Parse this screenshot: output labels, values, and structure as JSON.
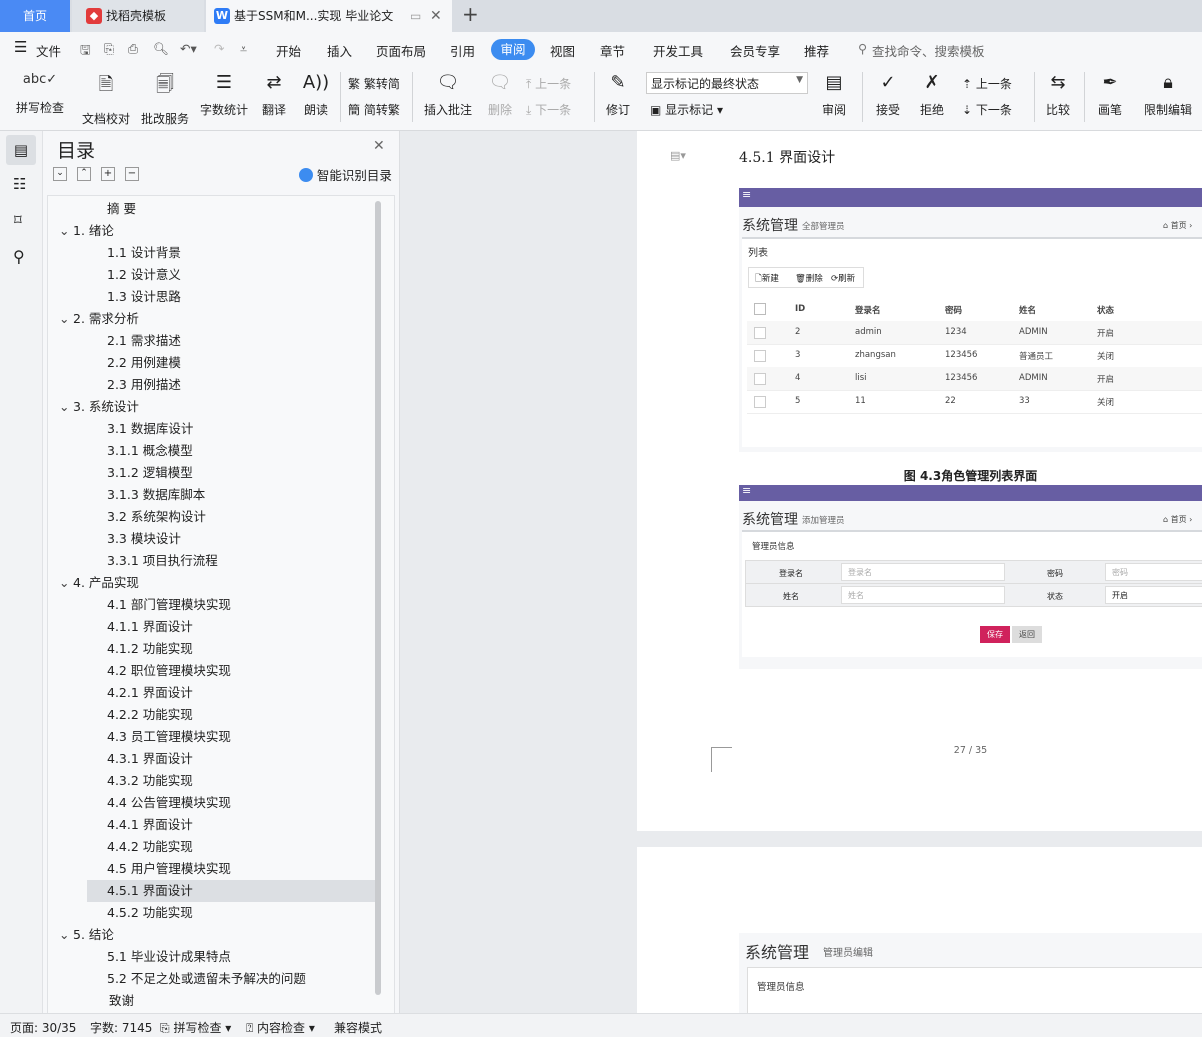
{
  "tabs": {
    "home": "首页",
    "template": "找稻壳模板",
    "document": "基于SSM和M...实现 毕业论文"
  },
  "menu": {
    "file": "文件",
    "items": [
      "开始",
      "插入",
      "页面布局",
      "引用",
      "审阅",
      "视图",
      "章节",
      "开发工具",
      "会员专享",
      "推荐"
    ],
    "search_placeholder": "查找命令、搜索模板"
  },
  "ribbon": {
    "spellcheck": "拼写检查",
    "doc_proof": "文档校对",
    "batch_service": "批改服务",
    "word_count": "字数统计",
    "translate": "翻译",
    "read_aloud": "朗读",
    "to_traditional": "繁转简",
    "to_simplified": "简转繁",
    "insert_comment": "插入批注",
    "delete": "删除",
    "prev_comment": "上一条",
    "next_comment": "下一条",
    "revise": "修订",
    "markup_state": "显示标记的最终状态",
    "show_markup": "显示标记",
    "review": "审阅",
    "accept": "接受",
    "reject": "拒绝",
    "prev_change": "上一条",
    "next_change": "下一条",
    "compare": "比较",
    "pen": "画笔",
    "restrict_edit": "限制编辑"
  },
  "toc": {
    "title": "目录",
    "smart_detect": "智能识别目录",
    "items": [
      {
        "text": "摘  要",
        "level": 1,
        "arrow": false
      },
      {
        "text": "1.   绪论",
        "level": 0,
        "arrow": true
      },
      {
        "text": "1.1 设计背景",
        "level": 1,
        "arrow": false
      },
      {
        "text": "1.2 设计意义",
        "level": 1,
        "arrow": false
      },
      {
        "text": "1.3 设计思路",
        "level": 1,
        "arrow": false
      },
      {
        "text": "2. 需求分析",
        "level": 0,
        "arrow": true
      },
      {
        "text": "2.1 需求描述",
        "level": 1,
        "arrow": false
      },
      {
        "text": "2.2 用例建模",
        "level": 1,
        "arrow": false
      },
      {
        "text": "2.3 用例描述",
        "level": 1,
        "arrow": false
      },
      {
        "text": "3. 系统设计",
        "level": 0,
        "arrow": true
      },
      {
        "text": "3.1 数据库设计",
        "level": 1,
        "arrow": false
      },
      {
        "text": "3.1.1 概念模型",
        "level": 1,
        "arrow": false
      },
      {
        "text": "3.1.2 逻辑模型",
        "level": 1,
        "arrow": false
      },
      {
        "text": "3.1.3 数据库脚本",
        "level": 1,
        "arrow": false
      },
      {
        "text": "3.2 系统架构设计",
        "level": 1,
        "arrow": false
      },
      {
        "text": "3.3 模块设计",
        "level": 1,
        "arrow": false
      },
      {
        "text": "3.3.1 项目执行流程",
        "level": 1,
        "arrow": false
      },
      {
        "text": "4. 产品实现",
        "level": 0,
        "arrow": true
      },
      {
        "text": "4.1 部门管理模块实现",
        "level": 1,
        "arrow": false
      },
      {
        "text": "4.1.1 界面设计",
        "level": 1,
        "arrow": false
      },
      {
        "text": "4.1.2 功能实现",
        "level": 1,
        "arrow": false
      },
      {
        "text": "4.2 职位管理模块实现",
        "level": 1,
        "arrow": false
      },
      {
        "text": "4.2.1 界面设计",
        "level": 1,
        "arrow": false
      },
      {
        "text": "4.2.2 功能实现",
        "level": 1,
        "arrow": false
      },
      {
        "text": "4.3 员工管理模块实现",
        "level": 1,
        "arrow": false
      },
      {
        "text": "4.3.1 界面设计",
        "level": 1,
        "arrow": false
      },
      {
        "text": "4.3.2 功能实现",
        "level": 1,
        "arrow": false
      },
      {
        "text": "4.4 公告管理模块实现",
        "level": 1,
        "arrow": false
      },
      {
        "text": "4.4.1 界面设计",
        "level": 1,
        "arrow": false
      },
      {
        "text": "4.4.2 功能实现",
        "level": 1,
        "arrow": false
      },
      {
        "text": "4.5 用户管理模块实现",
        "level": 1,
        "arrow": false
      },
      {
        "text": "4.5.1 界面设计",
        "level": 1,
        "arrow": false,
        "selected": true
      },
      {
        "text": "4.5.2 功能实现",
        "level": 1,
        "arrow": false
      },
      {
        "text": "5. 结论",
        "level": 0,
        "arrow": true
      },
      {
        "text": "5.1 毕业设计成果特点",
        "level": 1,
        "arrow": false
      },
      {
        "text": "5.2 不足之处或遗留未予解决的问题",
        "level": 1,
        "arrow": false
      },
      {
        "text": "致谢",
        "level": 2,
        "arrow": false
      }
    ]
  },
  "doc": {
    "heading": "4.5.1 界面设计",
    "shot1": {
      "title": "系统管理",
      "subtitle": "全部管理员",
      "home": "首页",
      "list_label": "列表",
      "buttons": [
        "新建",
        "删除",
        "刷新"
      ],
      "columns": [
        "ID",
        "登录名",
        "密码",
        "姓名",
        "状态"
      ],
      "rows": [
        [
          "2",
          "admin",
          "1234",
          "ADMIN",
          "开启"
        ],
        [
          "3",
          "zhangsan",
          "123456",
          "普通员工",
          "关闭"
        ],
        [
          "4",
          "lisi",
          "123456",
          "ADMIN",
          "开启"
        ],
        [
          "5",
          "11",
          "22",
          "33",
          "关闭"
        ]
      ]
    },
    "caption": "图 4.3角色管理列表界面",
    "shot2": {
      "title": "系统管理",
      "subtitle": "添加管理员",
      "home": "首页",
      "section": "管理员信息",
      "login_label": "登录名",
      "login_placeholder": "登录名",
      "password_label": "密码",
      "password_placeholder": "密码",
      "name_label": "姓名",
      "name_placeholder": "姓名",
      "status_label": "状态",
      "status_value": "开启",
      "save": "保存",
      "back": "返回"
    },
    "page_number": "27 / 35",
    "shot3": {
      "title": "系统管理",
      "subtitle": "管理员编辑",
      "section": "管理员信息"
    }
  },
  "status": {
    "page": "页面: 30/35",
    "words": "字数: 7145",
    "spell": "拼写检查",
    "content": "内容检查",
    "compat": "兼容模式"
  },
  "colors": {
    "accent": "#3c8cf0",
    "header_purple": "#675ea3",
    "save_red": "#d0225c"
  }
}
